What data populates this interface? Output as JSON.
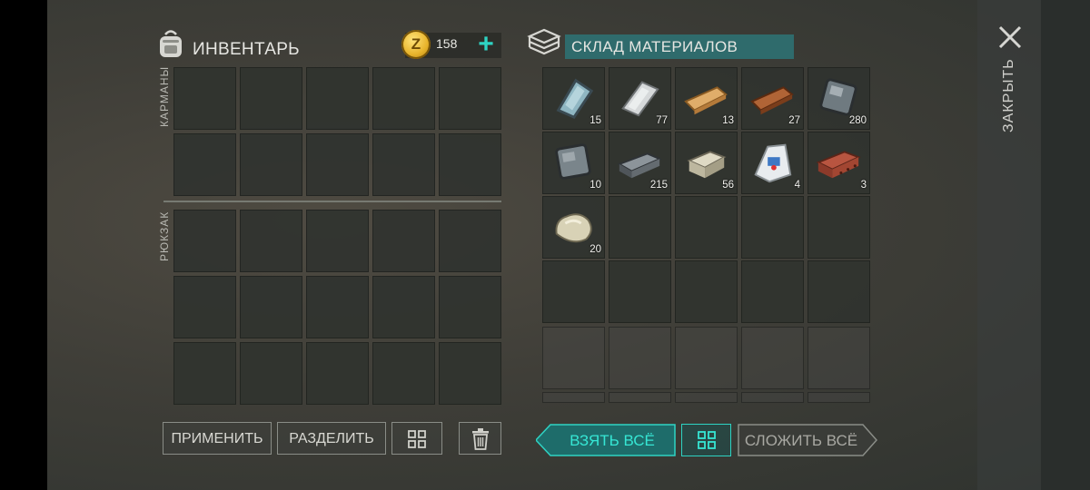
{
  "inventory": {
    "title": "ИНВЕНТАРЬ",
    "pockets_label": "КАРМАНЫ",
    "backpack_label": "РЮКЗАК",
    "coins": "158",
    "coin_symbol": "Z",
    "add_coins_icon": "plus-icon",
    "backpack_icon": "backpack-icon"
  },
  "storage": {
    "title": "СКЛАД МАТЕРИАЛОВ",
    "icon": "stack-icon",
    "items": [
      {
        "name": "glass-sheet",
        "qty": "15"
      },
      {
        "name": "metal-sheet",
        "qty": "77"
      },
      {
        "name": "wooden-plank",
        "qty": "13"
      },
      {
        "name": "dark-plank",
        "qty": "27"
      },
      {
        "name": "iron-plate",
        "qty": "280"
      },
      {
        "name": "steel-plate",
        "qty": "10"
      },
      {
        "name": "iron-ingot",
        "qty": "215"
      },
      {
        "name": "stone-block",
        "qty": "56"
      },
      {
        "name": "cement-bag",
        "qty": "4"
      },
      {
        "name": "brick",
        "qty": "3"
      },
      {
        "name": "rock",
        "qty": "20"
      }
    ]
  },
  "buttons": {
    "apply": "ПРИМЕНИТЬ",
    "split": "РАЗДЕЛИТЬ",
    "sort_icon": "grid-icon",
    "trash_icon": "trash-icon",
    "take_all": "ВЗЯТЬ ВСЁ",
    "put_all": "СЛОЖИТЬ ВСЁ"
  },
  "close": {
    "label": "ЗАКРЫТЬ",
    "icon": "close-icon"
  },
  "colors": {
    "accent": "#2ed3c3",
    "title_box": "#2f6b6c"
  }
}
